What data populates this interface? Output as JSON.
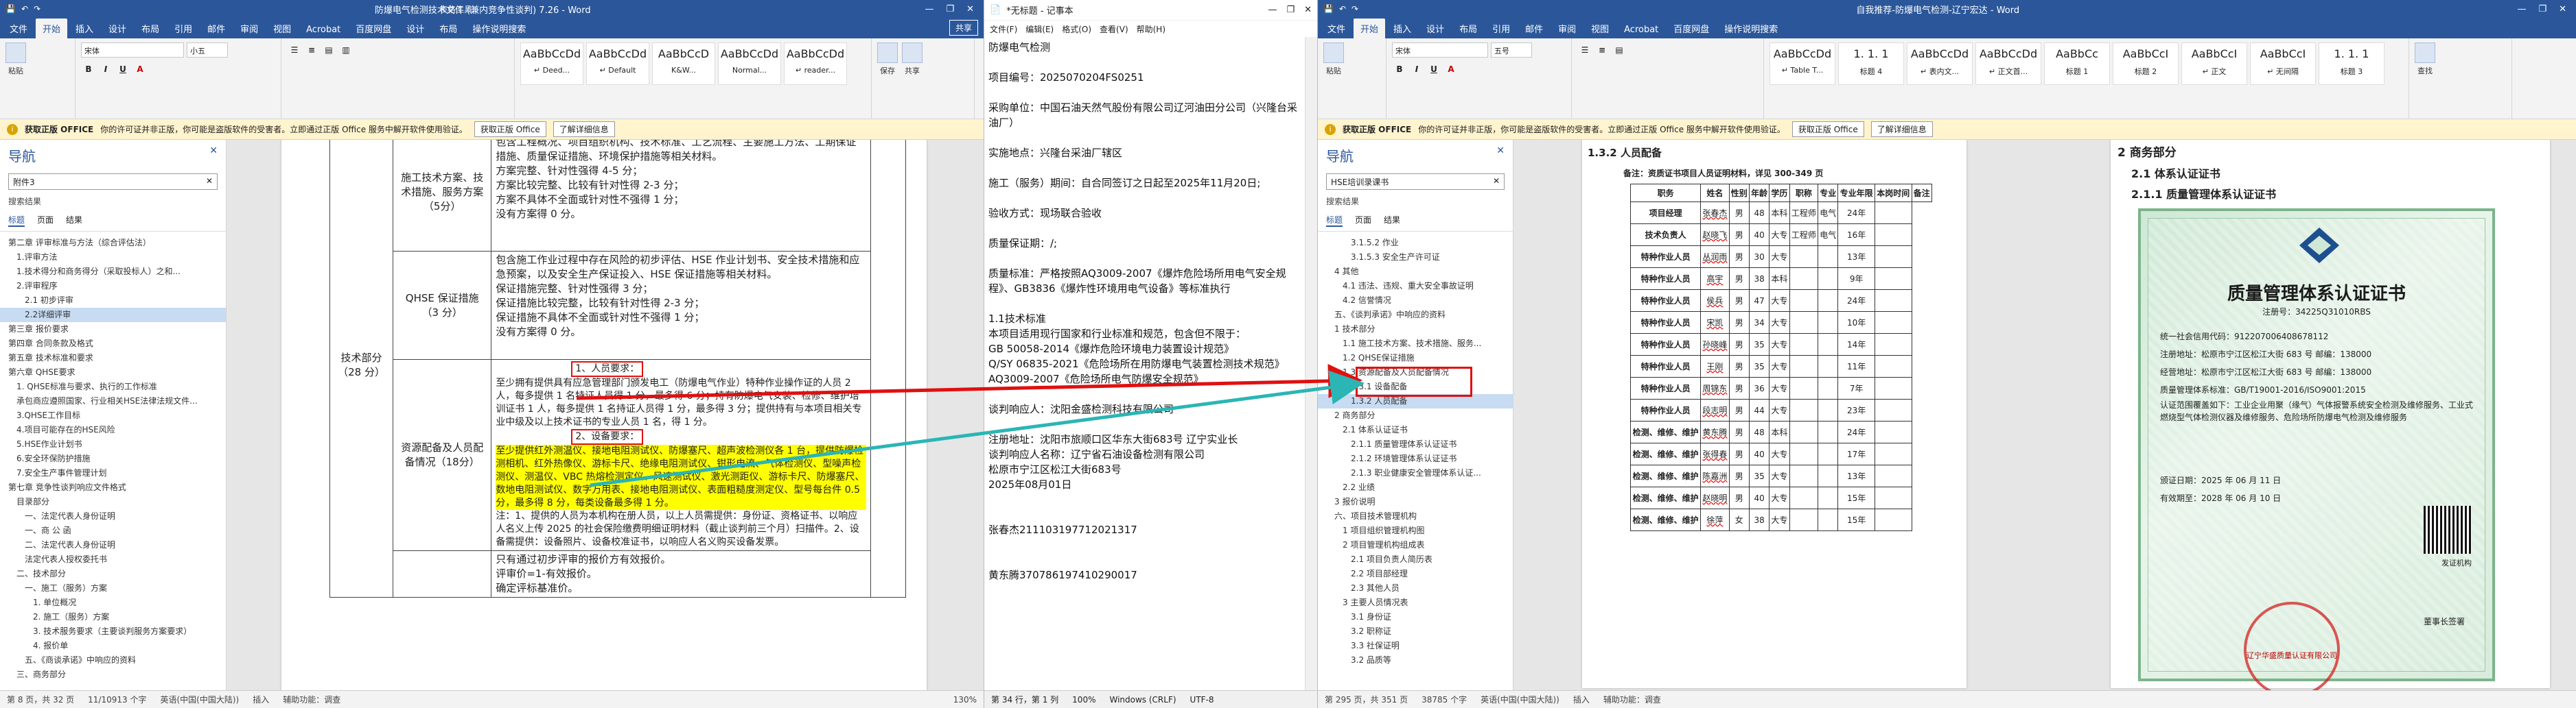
{
  "win1": {
    "title": "防爆电气检测技术文件 (兼内竞争性谈判) 7.26 - Word",
    "context": "表格工具",
    "tabs": [
      "文件",
      "开始",
      "插入",
      "设计",
      "布局",
      "引用",
      "邮件",
      "审阅",
      "视图",
      "Acrobat",
      "百度网盘",
      "设计",
      "布局",
      "操作说明搜索"
    ],
    "share": "共享",
    "font_name": "宋体",
    "font_size": "小五",
    "styles": [
      {
        "preview": "AaBbCcDd",
        "name": "↵ Deed..."
      },
      {
        "preview": "AaBbCcDd",
        "name": "↵ Default"
      },
      {
        "preview": "AaBbCcD",
        "name": "K&W..."
      },
      {
        "preview": "AaBbCcDd",
        "name": "Normal..."
      },
      {
        "preview": "AaBbCcDd",
        "name": "↵ reader..."
      }
    ],
    "msg": {
      "badge": "获取正版 OFFICE",
      "text": "你的许可证并非正版，你可能是盗版软件的受害者。立即通过正版 Office 服务中解开软件使用验证。",
      "btn1": "获取正版 Office",
      "btn2": "了解详细信息"
    },
    "nav": {
      "title": "导航",
      "search": "附件3",
      "results_label": "搜索结果",
      "tabs": [
        "标题",
        "页面",
        "结果"
      ],
      "items": [
        {
          "t": "第二章  评审标准与方法（综合评估法）",
          "l": 1
        },
        {
          "t": "1.评审方法",
          "l": 2
        },
        {
          "t": "1.技术得分和商务得分（采取投标人）之和...",
          "l": 2
        },
        {
          "t": "2.评审程序",
          "l": 2
        },
        {
          "t": "2.1 初步评审",
          "l": 3
        },
        {
          "t": "2.2详细评审",
          "l": 3,
          "sel": true
        },
        {
          "t": "第三章  报价要求",
          "l": 1
        },
        {
          "t": "第四章  合同条款及格式",
          "l": 1
        },
        {
          "t": "第五章  技术标准和要求",
          "l": 1
        },
        {
          "t": "第六章  QHSE要求",
          "l": 1
        },
        {
          "t": "1. QHSE标准与要求、执行的工作标准",
          "l": 2
        },
        {
          "t": "承包商应遵照国家、行业相关HSE法律法规文件...",
          "l": 2
        },
        {
          "t": "3.QHSE工作目标",
          "l": 2
        },
        {
          "t": "4.项目可能存在的HSE风险",
          "l": 2
        },
        {
          "t": "5.HSE作业计划书",
          "l": 2
        },
        {
          "t": "6.安全环保防护措施",
          "l": 2
        },
        {
          "t": "7.安全生产事件管理计划",
          "l": 2
        },
        {
          "t": "第七章  竞争性谈判响应文件格式",
          "l": 1
        },
        {
          "t": "目录部分",
          "l": 2
        },
        {
          "t": "一、法定代表人身份证明",
          "l": 3
        },
        {
          "t": "一、商 公 函",
          "l": 3
        },
        {
          "t": "二、法定代表人身份证明",
          "l": 3
        },
        {
          "t": "法定代表人授权委托书",
          "l": 3
        },
        {
          "t": "二、技术部分",
          "l": 2
        },
        {
          "t": "一、施工（服务）方案",
          "l": 3
        },
        {
          "t": "1. 单位概况",
          "l": 4
        },
        {
          "t": "2. 施工（服务）方案",
          "l": 4
        },
        {
          "t": "3. 技术服务要求（主要谈判服务方案要求）",
          "l": 4
        },
        {
          "t": "4. 报价单",
          "l": 4
        },
        {
          "t": "五、《商谈承诺》中响应的资料",
          "l": 3
        },
        {
          "t": "三、商务部分",
          "l": 2
        }
      ]
    },
    "table": {
      "tech_label": "技术部分",
      "tech_score": "（28 分）",
      "r1_label": "施工技术方案、技术措施、服务方案",
      "r1_score": "（5分）",
      "r1_text": [
        "包含工程概况、项目组织机构、技术标准、工艺流程、主要施工方法、工期保证措施、质量保证措施、环境保护措施等相关材料。",
        "方案完整、针对性强得 4-5 分；",
        "方案比较完整、比较有针对性得 2-3 分；",
        "方案不具体不全面或针对性不强得 1 分；",
        "没有方案得 0 分。"
      ],
      "r2_label": "QHSE 保证措施",
      "r2_score": "（3 分）",
      "r2_text": [
        "包含施工作业过程中存在风险的初步评估、HSE 作业计划书、安全技术措施和应急预案，以及安全生产保证投入、HSE 保证措施等相关材料。",
        "保证措施完整、针对性强得 3 分；",
        "保证措施比较完整，比较有针对性得 2-3 分；",
        "保证措施不具体不全面或针对性不强得 1 分；",
        "没有方案得 0 分。"
      ],
      "r3_label": "资源配备及人员配备情况（18分）",
      "r3_h1": "1、人员要求：",
      "r3_p1": "至少拥有提供具有应急管理部门颁发电工（防爆电气作业）特种作业操作证的人员 2 人，每多提供 1 名特证人员得 1 分，最多得 6 分；持有防爆电气安装、检修、维护培训证书 1 人，每多提供 1 名持证人员得 1 分，最多得 3 分；提供持有与本项目相关专业中级及以上技术证书的专业人员 1 名，得 1 分。",
      "r3_h2": "2、设备要求：",
      "r3_p2": "至少提供红外测温仪、接地电阻测试仪、防爆塞尺、超声波检测仪各 1 台，提供防爆检测相机、红外热像仪、游标卡尺、绝缘电阻测试仪、钳形电流、气体检测仪、型噪声检测仪、测温仪、VBC 热熔检测定仪、风速测试仪、激光测距仪、游标卡尺、防爆塞尺、数地电阻测试仪、数字万用表、接地电阻测试仪、表面粗糙度测定仪、型号每台件 0.5 分，最多得 8 分，每类设备最多得 1 分。",
      "r3_p3": "注：1、提供的人员为本机构在册人员，以上人员需提供：身份证、资格证书、以响应人名义上传 2025 的社会保险缴费明细证明材料（截止谈判前三个月）扫描件。2、设备需提供：设备照片、设备校准证书，以响应人名义购买设备发票。",
      "r4_text": [
        "只有通过初步评审的报价方有效报价。",
        "评审价=1-有效报价。",
        "确定评标基准价。"
      ]
    },
    "status": [
      "第 8 页，共 32 页",
      "11/10913 个字",
      "英语(中国(中国大陆))",
      "插入",
      "辅助功能：调查"
    ],
    "zoom": "130%"
  },
  "win2": {
    "title": "*无标题 - 记事本",
    "menu": [
      "文件(F)",
      "编辑(E)",
      "格式(O)",
      "查看(V)",
      "帮助(H)"
    ],
    "lines": [
      "防爆电气检测",
      "",
      "项目编号：2025070204FS0251",
      "",
      "采购单位：中国石油天然气股份有限公司辽河油田分公司（兴隆台采油厂）",
      "",
      "实施地点：兴隆台采油厂辖区",
      "",
      "施工（服务）期间：自合同签订之日起至2025年11月20日;",
      "",
      "验收方式：现场联合验收",
      "",
      "质量保证期：/;",
      "",
      "质量标准：严格按照AQ3009-2007《爆炸危险场所用电气安全规程》、GB3836《爆炸性环境用电气设备》等标准执行",
      "",
      "1.1技术标准",
      "本项目适用现行国家和行业标准和规范，包含但不限于：",
      "GB 50058-2014《爆炸危险环境电力装置设计规范》",
      "Q/SY 06835-2021《危险场所在用防爆电气装置检测技术规范》",
      "AQ3009-2007《危险场所电气防爆安全规范》",
      "",
      "谈判响应人：沈阳金盛检测科技有限公司",
      "",
      "注册地址：沈阳市旅顺口区华东大街683号 辽宁实业长",
      "谈判响应人名称：辽宁省石油设备检测有限公司",
      "松原市宁江区松江大街683号",
      "2025年08月01日",
      "",
      "",
      "张春杰211103197712021317",
      "",
      "",
      "黄东腾370786197410290017"
    ],
    "status": [
      "第 34 行，第 1 列",
      "100%",
      "Windows (CRLF)",
      "UTF-8"
    ]
  },
  "win3": {
    "title": "自我推荐-防爆电气检测-辽宁宏达 - Word",
    "tabs": [
      "文件",
      "开始",
      "插入",
      "设计",
      "布局",
      "引用",
      "邮件",
      "审阅",
      "视图",
      "Acrobat",
      "百度网盘",
      "操作说明搜索"
    ],
    "font_name": "宋体",
    "font_size": "五号",
    "styles": [
      {
        "preview": "AaBbCcDd",
        "name": "↵ Table T..."
      },
      {
        "preview": "1. 1. 1",
        "name": "标题 4"
      },
      {
        "preview": "AaBbCcDd",
        "name": "↵ 表内文..."
      },
      {
        "preview": "AaBbCcDd",
        "name": "↵ 正文首..."
      },
      {
        "preview": "AaBbCc",
        "name": "标题 1"
      },
      {
        "preview": "AaBbCcI",
        "name": "标题 2"
      },
      {
        "preview": "AaBbCcI",
        "name": "↵ 正文"
      },
      {
        "preview": "AaBbCcI",
        "name": "↵ 无间隔"
      },
      {
        "preview": "1. 1. 1",
        "name": "标题 3"
      }
    ],
    "msg": {
      "badge": "获取正版 OFFICE",
      "text": "你的许可证并非正版，你可能是盗版软件的受害者。立即通过正版 Office 服务中解开软件使用验证。",
      "btn1": "获取正版 Office",
      "btn2": "了解详细信息"
    },
    "nav": {
      "title": "导航",
      "search": "HSE培训录课书",
      "results_label": "搜索结果",
      "tabs": [
        "标题",
        "页面",
        "结果"
      ],
      "items": [
        {
          "t": "3.1.5.2 作业",
          "l": 4
        },
        {
          "t": "3.1.5.3 安全生产许可证",
          "l": 4
        },
        {
          "t": "4 其他",
          "l": 2
        },
        {
          "t": "4.1 违法、违规、重大安全事故证明",
          "l": 3
        },
        {
          "t": "4.2 信誉情况",
          "l": 3
        },
        {
          "t": "五、《谈判承诺》中响应的资料",
          "l": 2
        },
        {
          "t": "1 技术部分",
          "l": 2
        },
        {
          "t": "1.1 施工技术方案、技术措施、服务...",
          "l": 3
        },
        {
          "t": "1.2 QHSE保证措施",
          "l": 3
        },
        {
          "t": "1.3 资源配备及人员配备情况",
          "l": 3
        },
        {
          "t": "1.3.1 设备配备",
          "l": 4
        },
        {
          "t": "1.3.2 人员配备",
          "l": 4,
          "sel": true
        },
        {
          "t": "2 商务部分",
          "l": 2
        },
        {
          "t": "2.1 体系认证证书",
          "l": 3
        },
        {
          "t": "2.1.1 质量管理体系认证证书",
          "l": 4
        },
        {
          "t": "2.1.2 环境管理体系认证证书",
          "l": 4
        },
        {
          "t": "2.1.3 职业健康安全管理体系认证...",
          "l": 4
        },
        {
          "t": "2.2 业绩",
          "l": 3
        },
        {
          "t": "3 报价说明",
          "l": 2
        },
        {
          "t": "六、项目技术管理机构",
          "l": 2
        },
        {
          "t": "1 项目组织管理机构图",
          "l": 3
        },
        {
          "t": "2 项目管理机构组成表",
          "l": 3
        },
        {
          "t": "2.1 项目负责人简历表",
          "l": 4
        },
        {
          "t": "2.2 项目部经理",
          "l": 4
        },
        {
          "t": "2.3 其他人员",
          "l": 4
        },
        {
          "t": "3 主要人员情况表",
          "l": 3
        },
        {
          "t": "3.1 身份证",
          "l": 4
        },
        {
          "t": "3.2 职称证",
          "l": 4
        },
        {
          "t": "3.3 社保证明",
          "l": 4
        },
        {
          "t": "3.2 品质等",
          "l": 4
        }
      ]
    },
    "heading_left": "1.3.2 人员配备",
    "staff_caption": "备注：资质证书项目人员证明材料，详见 300-349 页",
    "staff_headers": [
      "职务",
      "姓名",
      "性别",
      "年龄",
      "学历",
      "职称",
      "专业",
      "专业年限",
      "本岗时间",
      "备注"
    ],
    "staff_rows": [
      [
        "项目经理",
        "张春杰",
        "男",
        "48",
        "本科",
        "工程师",
        "电气",
        "24年",
        ""
      ],
      [
        "技术负责人",
        "赵晓飞",
        "男",
        "40",
        "大专",
        "工程师",
        "电气",
        "16年",
        ""
      ],
      [
        "特种作业人员",
        "丛润雨",
        "男",
        "30",
        "大专",
        "",
        "",
        "13年",
        ""
      ],
      [
        "特种作业人员",
        "高宇",
        "男",
        "38",
        "本科",
        "",
        "",
        "9年",
        ""
      ],
      [
        "特种作业人员",
        "侯兵",
        "男",
        "47",
        "大专",
        "",
        "",
        "24年",
        ""
      ],
      [
        "特种作业人员",
        "宋凯",
        "男",
        "34",
        "大专",
        "",
        "",
        "10年",
        ""
      ],
      [
        "特种作业人员",
        "孙晓峰",
        "男",
        "35",
        "大专",
        "",
        "",
        "14年",
        ""
      ],
      [
        "特种作业人员",
        "王刚",
        "男",
        "35",
        "大专",
        "",
        "",
        "11年",
        ""
      ],
      [
        "特种作业人员",
        "周锦东",
        "男",
        "36",
        "大专",
        "",
        "",
        "7年",
        ""
      ],
      [
        "特种作业人员",
        "段志明",
        "男",
        "44",
        "大专",
        "",
        "",
        "23年",
        ""
      ],
      [
        "检测、维修、维护",
        "黄东腾",
        "男",
        "48",
        "本科",
        "",
        "",
        "24年",
        ""
      ],
      [
        "检测、维修、维护",
        "张得春",
        "男",
        "40",
        "大专",
        "",
        "",
        "17年",
        ""
      ],
      [
        "检测、维修、维护",
        "陈嘉洲",
        "男",
        "35",
        "大专",
        "",
        "",
        "13年",
        ""
      ],
      [
        "检测、维修、维护",
        "赵晓明",
        "男",
        "40",
        "大专",
        "",
        "",
        "15年",
        ""
      ],
      [
        "检测、维修、维护",
        "徐萍",
        "女",
        "38",
        "大专",
        "",
        "",
        "15年",
        ""
      ]
    ],
    "right_h1": "2  商务部分",
    "right_h2": "2.1  体系认证证书",
    "right_h3": "2.1.1  质量管理体系认证证书",
    "cert": {
      "title": "质量管理体系认证证书",
      "no": "注册号：34225Q31010RBS",
      "company": "统一社会信用代码：912207006408678112",
      "addr1": "注册地址：松原市宁江区松江大街 683 号   邮编：138000",
      "addr2": "经营地址：松原市宁江区松江大街 683 号   邮编：138000",
      "std": "质量管理体系标准：GB/T19001-2016/ISO9001:2015",
      "scope": "认证范围覆盖如下：工业企业用聚（缘气）气体报警系统安全检测及维修服务、工业式燃烧型气体检测仪器及维修服务、危险场所防爆电气检测及维修服务",
      "date1": "颁证日期：2025 年 06 月 11 日",
      "date2": "有效期至：2028 年 06 月 10 日",
      "issuer": "辽宁华盛质量认证有限公司",
      "sign": "董事长签署",
      "issuer_label": "发证机构"
    },
    "status": [
      "第 295 页，共 351 页",
      "38785 个字",
      "英语(中国(中国大陆))",
      "插入",
      "辅助功能：调查"
    ]
  },
  "colors": {
    "word_blue": "#2b579a",
    "highlight": "#ffff00",
    "red": "#e01010",
    "arrow": "#2bb5b5"
  }
}
